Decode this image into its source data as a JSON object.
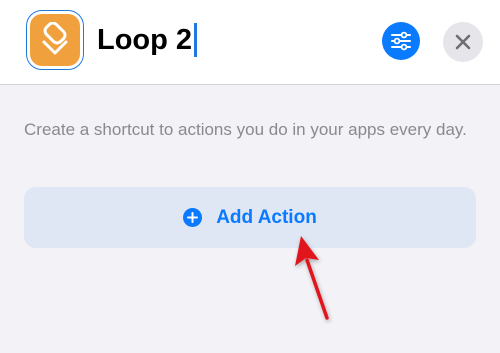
{
  "header": {
    "title": "Loop 2",
    "app_icon": "layers-icon",
    "app_icon_color": "#f0a03c",
    "settings_icon": "sliders-icon",
    "settings_color": "#0a7aff",
    "close_icon": "close-icon"
  },
  "main": {
    "description": "Create a shortcut to actions you do in your apps every day.",
    "add_action_label": "Add Action",
    "add_action_icon": "plus-circle-icon"
  },
  "annotation": {
    "arrow_color": "#e0131e",
    "arrow_icon": "pointer-arrow-icon"
  }
}
